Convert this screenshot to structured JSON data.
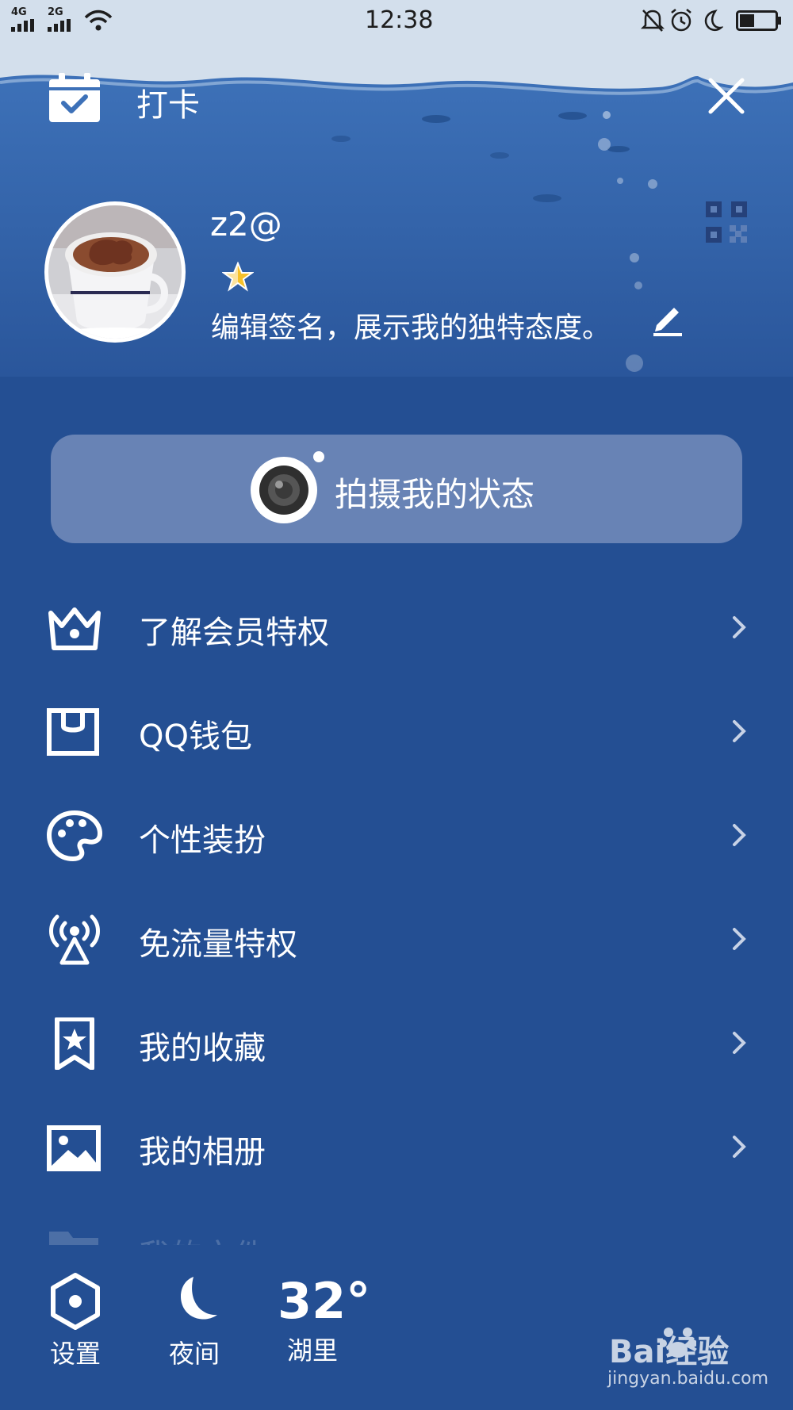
{
  "status_bar": {
    "network_1": "4G",
    "network_2": "2G",
    "time": "12:38"
  },
  "header": {
    "checkin_label": "打卡"
  },
  "profile": {
    "username": "z2@",
    "signature": "编辑签名，展示我的独特态度。"
  },
  "camera": {
    "label": "拍摄我的状态"
  },
  "menu": {
    "items": [
      {
        "label": "了解会员特权",
        "icon": "crown-icon"
      },
      {
        "label": "QQ钱包",
        "icon": "wallet-icon"
      },
      {
        "label": "个性装扮",
        "icon": "palette-icon"
      },
      {
        "label": "免流量特权",
        "icon": "signal-tower-icon"
      },
      {
        "label": "我的收藏",
        "icon": "bookmark-star-icon"
      },
      {
        "label": "我的相册",
        "icon": "photo-icon"
      },
      {
        "label": "我的文件",
        "icon": "folder-icon"
      }
    ]
  },
  "bottom": {
    "settings_label": "设置",
    "night_label": "夜间",
    "temperature": "32°",
    "city": "湖里"
  },
  "watermark": {
    "brand": "Bai经验",
    "url": "jingyan.baidu.com"
  },
  "colors": {
    "background": "#244f93",
    "camera_button": "#6883b5",
    "status_bar": "#d3dfec"
  }
}
